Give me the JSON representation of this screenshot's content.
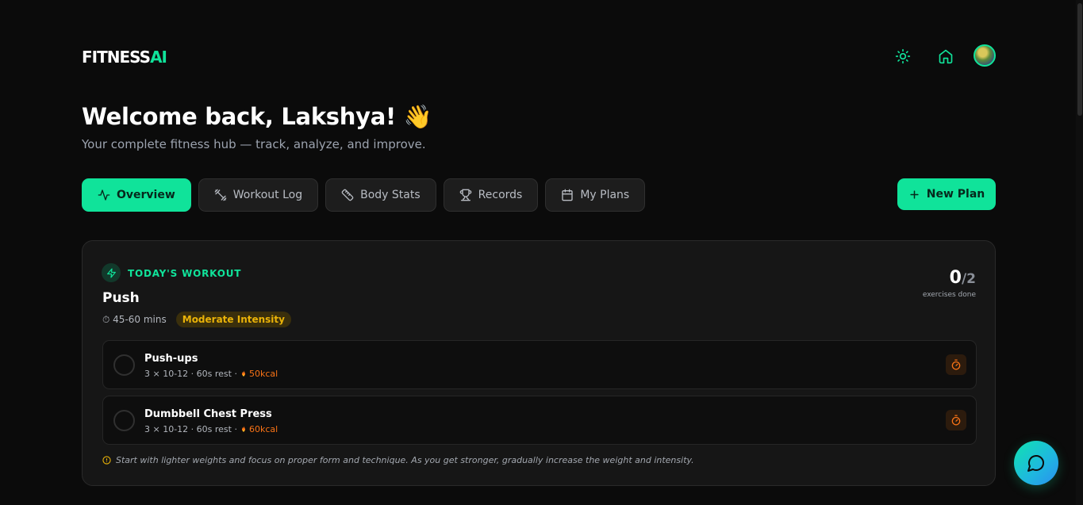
{
  "header": {
    "logo_main": "FITNESS",
    "logo_accent": "AI",
    "icons": [
      "sun-icon",
      "home-icon"
    ],
    "avatar": "user-avatar"
  },
  "hero": {
    "welcome": "Welcome back, Lakshya! 👋",
    "subtitle": "Your complete fitness hub — track, analyze, and improve."
  },
  "tabs": [
    {
      "label": "Overview",
      "icon": "activity-icon",
      "active": true
    },
    {
      "label": "Workout Log",
      "icon": "dumbbell-icon",
      "active": false
    },
    {
      "label": "Body Stats",
      "icon": "ruler-icon",
      "active": false
    },
    {
      "label": "Records",
      "icon": "trophy-icon",
      "active": false
    },
    {
      "label": "My Plans",
      "icon": "calendar-icon",
      "active": false
    }
  ],
  "new_plan": {
    "label": "New Plan",
    "icon": "plus-icon"
  },
  "today": {
    "section_label": "TODAY'S WORKOUT",
    "workout_name": "Push",
    "duration": "⏱ 45-60 mins",
    "intensity": "Moderate Intensity",
    "done_count": "0",
    "total_count": "/2",
    "progress_caption": "exercises done",
    "exercises": [
      {
        "name": "Push-ups",
        "detail": "3 × 10-12 · 60s rest ·",
        "kcal": "50kcal"
      },
      {
        "name": "Dumbbell Chest Press",
        "detail": "3 × 10-12 · 60s rest ·",
        "kcal": "60kcal"
      }
    ],
    "tip": "Start with lighter weights and focus on proper form and technique. As you get stronger, gradually increase the weight and intensity."
  },
  "colors": {
    "accent": "#10e39a",
    "background": "#0b0b0b",
    "card": "#161616",
    "intensity": "#eab308",
    "kcal": "#f97316"
  }
}
